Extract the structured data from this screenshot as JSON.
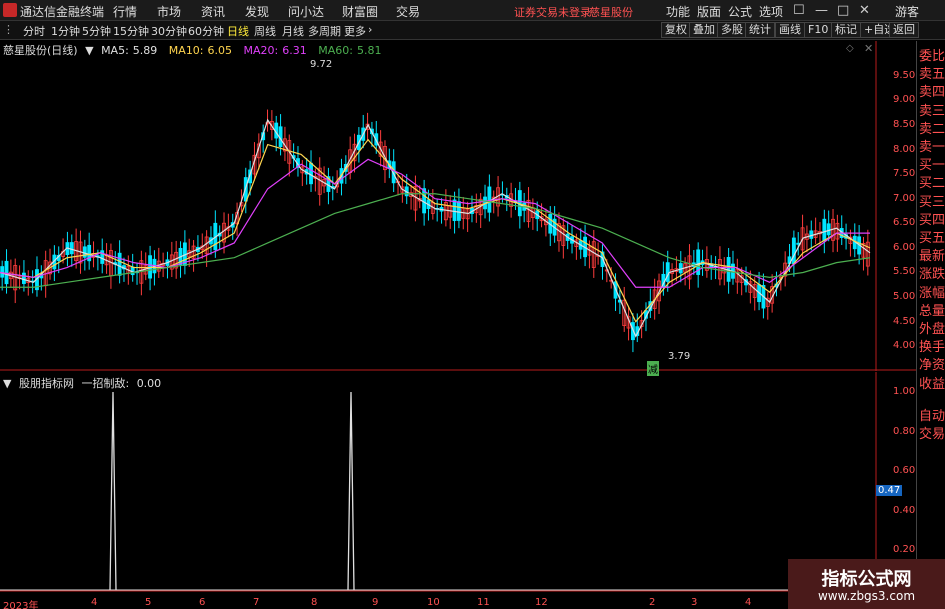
{
  "menubar": {
    "app_name": "通达信金融终端",
    "menus": [
      "行情",
      "市场",
      "资讯",
      "发现",
      "问小达",
      "财富圈",
      "交易"
    ],
    "status": "证券交易未登录",
    "stock": "慈星股份",
    "right_menus": [
      "功能",
      "版面",
      "公式",
      "选项"
    ],
    "user": "游客"
  },
  "toolbar": {
    "periods": [
      "分时",
      "1分钟",
      "5分钟",
      "15分钟",
      "30分钟",
      "60分钟",
      "日线",
      "周线",
      "月线",
      "多周期",
      "更多"
    ],
    "active_period": "日线",
    "tools": [
      "复权",
      "叠加",
      "多股",
      "统计",
      "画线",
      "F10",
      "标记",
      "+自选",
      "返回"
    ]
  },
  "main_chart": {
    "title": "慈星股份(日线)",
    "ma": [
      {
        "label": "MA5:",
        "value": "5.89",
        "color": "#e0e0e0"
      },
      {
        "label": "MA10:",
        "value": "6.05",
        "color": "#ffd54f"
      },
      {
        "label": "MA20:",
        "value": "6.31",
        "color": "#e040fb"
      },
      {
        "label": "MA60:",
        "value": "5.81",
        "color": "#4caf50"
      }
    ],
    "high_marker": "9.72",
    "low_marker": "3.79",
    "low_tag": "减",
    "y_ticks": [
      "9.50",
      "9.00",
      "8.50",
      "8.00",
      "7.50",
      "7.00",
      "6.50",
      "6.00",
      "5.50",
      "5.00",
      "4.50",
      "4.00"
    ]
  },
  "indicator": {
    "name": "股朋指标网",
    "label": "一招制敌:",
    "value": "0.00",
    "y_ticks": [
      "1.00",
      "0.80",
      "0.60",
      "0.40",
      "0.20"
    ],
    "current": "0.47"
  },
  "x_axis": [
    "2023年",
    "4",
    "5",
    "6",
    "7",
    "8",
    "9",
    "10",
    "11",
    "12",
    "2",
    "3",
    "4"
  ],
  "right_panel": [
    "委比",
    "卖五",
    "卖四",
    "卖三",
    "卖二",
    "卖一",
    "买一",
    "买二",
    "买三",
    "买四",
    "买五",
    "最新",
    "涨跌",
    "涨幅",
    "总量",
    "外盘",
    "换手",
    "净资",
    "收益",
    "自动",
    "交易"
  ],
  "watermark": {
    "title": "指标公式网",
    "url": "www.zbgs3.com"
  },
  "colors": {
    "up": "#ff3d3d",
    "down": "#00e5ff",
    "axis": "#b71c1c"
  },
  "chart_data": {
    "type": "line",
    "title": "慈星股份(日线)",
    "x": [
      "2023年",
      "4",
      "5",
      "6",
      "7",
      "8",
      "9",
      "10",
      "11",
      "12",
      "2",
      "3",
      "4"
    ],
    "ylim": [
      3.7,
      9.8
    ],
    "series": [
      {
        "name": "MA5",
        "values": [
          5.5,
          5.3,
          6.0,
          5.8,
          5.5,
          5.7,
          6.0,
          6.5,
          8.6,
          7.6,
          7.2,
          8.5,
          7.2,
          6.8,
          6.7,
          7.1,
          6.7,
          6.2,
          5.8,
          4.2,
          5.5,
          5.7,
          5.5,
          4.9,
          6.2,
          6.4,
          5.9
        ]
      },
      {
        "name": "MA10",
        "values": [
          5.5,
          5.4,
          5.8,
          5.9,
          5.6,
          5.6,
          5.9,
          6.3,
          8.1,
          7.9,
          7.3,
          8.2,
          7.4,
          6.9,
          6.8,
          7.0,
          6.8,
          6.3,
          5.9,
          4.5,
          5.3,
          5.7,
          5.6,
          5.1,
          5.9,
          6.3,
          6.0
        ]
      },
      {
        "name": "MA20",
        "values": [
          5.5,
          5.4,
          5.6,
          5.9,
          5.7,
          5.6,
          5.8,
          6.1,
          7.2,
          7.7,
          7.3,
          7.8,
          7.5,
          7.0,
          6.9,
          7.0,
          6.9,
          6.5,
          6.1,
          5.2,
          5.2,
          5.6,
          5.6,
          5.3,
          5.8,
          6.3,
          6.3
        ]
      },
      {
        "name": "MA60",
        "values": [
          5.2,
          5.2,
          5.3,
          5.4,
          5.5,
          5.6,
          5.7,
          5.8,
          6.1,
          6.4,
          6.7,
          6.9,
          7.1,
          7.1,
          7.0,
          6.9,
          6.8,
          6.6,
          6.4,
          6.1,
          5.8,
          5.6,
          5.5,
          5.4,
          5.5,
          5.7,
          5.8
        ]
      }
    ],
    "indicator_spikes": [
      {
        "position": "2023-04",
        "value": 1.0
      },
      {
        "position": "2023-08",
        "value": 1.0
      }
    ]
  }
}
